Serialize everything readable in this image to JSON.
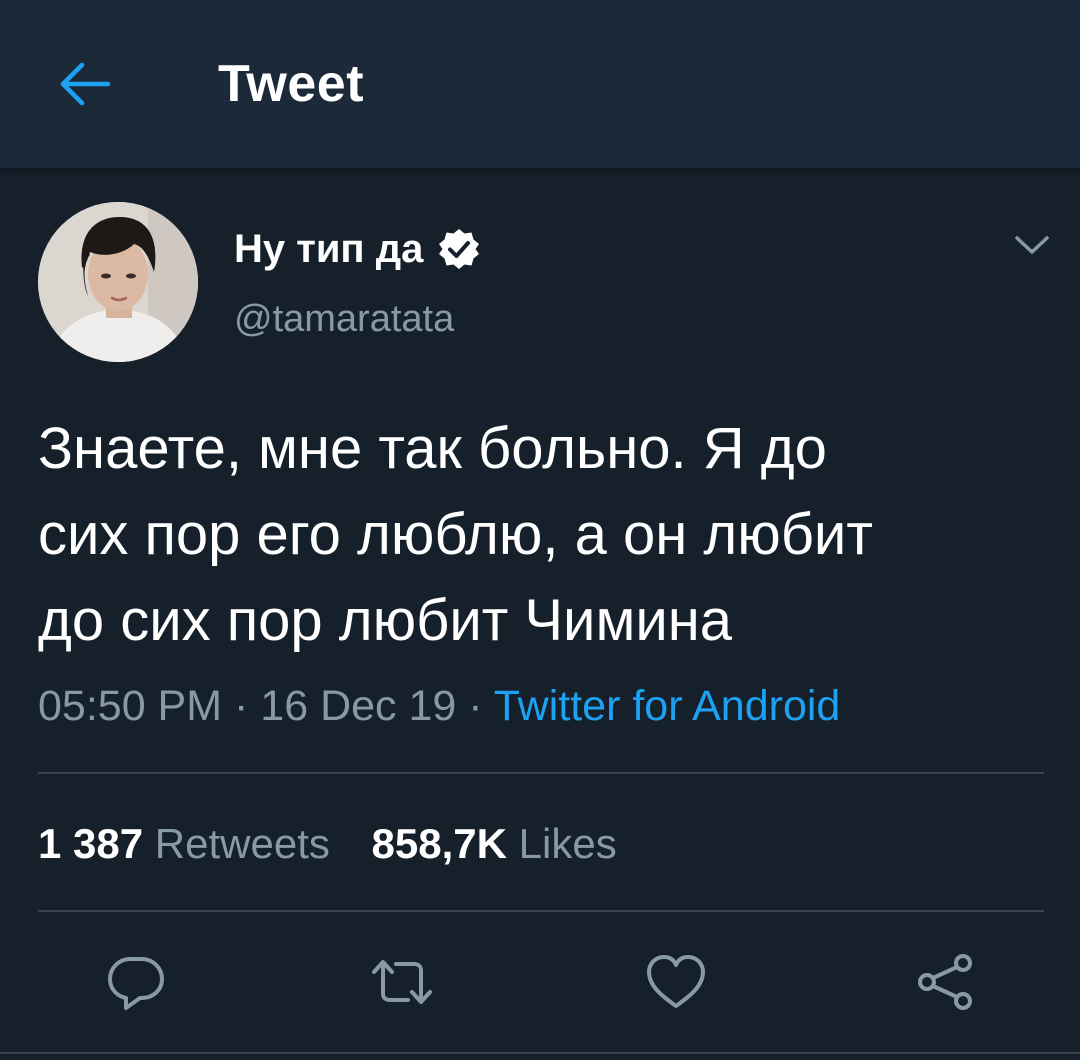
{
  "header": {
    "title": "Tweet",
    "back_icon": "arrow-left-icon"
  },
  "tweet": {
    "display_name": "Ну тип да",
    "handle": "@tamaratata",
    "verified": true,
    "text": "Знаете, мне так больно. Я до\nсих пор его люблю, а он любит\nдо сих пор любит Чимина",
    "time": "05:50 PM",
    "separator": "·",
    "date": "16 Dec 19",
    "source": "Twitter for Android"
  },
  "stats": {
    "retweets_count": "1 387",
    "retweets_label": "Retweets",
    "likes_count": "858,7K",
    "likes_label": "Likes"
  },
  "actions": [
    "reply-icon",
    "retweet-icon",
    "like-icon",
    "share-icon"
  ],
  "colors": {
    "background": "#15202b",
    "header_background": "#1c2938",
    "accent": "#1da1f2",
    "secondary_text": "#8899a6",
    "divider": "#38444d"
  }
}
